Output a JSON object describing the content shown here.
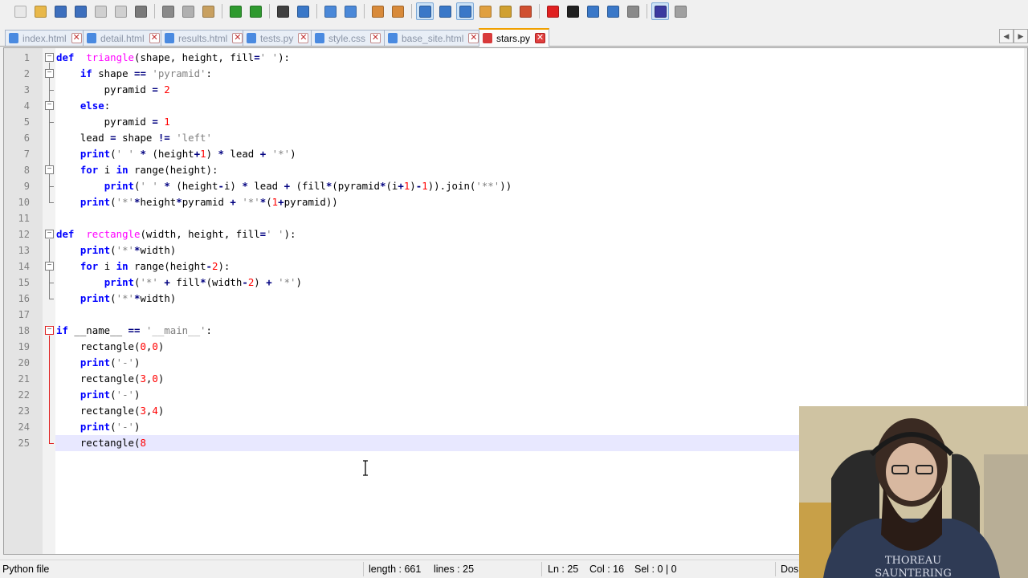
{
  "toolbar": {
    "buttons": [
      {
        "icon": "new-file-icon",
        "color": "#e8e8e8"
      },
      {
        "icon": "open-file-icon",
        "color": "#e8b84a"
      },
      {
        "icon": "save-icon",
        "color": "#3d6fbd"
      },
      {
        "icon": "save-all-icon",
        "color": "#3d6fbd"
      },
      {
        "icon": "close-icon",
        "color": "#d0d0d0"
      },
      {
        "icon": "close-all-icon",
        "color": "#d0d0d0"
      },
      {
        "icon": "print-icon",
        "color": "#7a7a7a"
      },
      {
        "sep": true
      },
      {
        "icon": "cut-icon",
        "color": "#8a8a8a"
      },
      {
        "icon": "copy-icon",
        "color": "#b0b0b0"
      },
      {
        "icon": "paste-icon",
        "color": "#c8a060"
      },
      {
        "sep": true
      },
      {
        "icon": "undo-icon",
        "color": "#2f9a2f"
      },
      {
        "icon": "redo-icon",
        "color": "#2f9a2f"
      },
      {
        "sep": true
      },
      {
        "icon": "find-icon",
        "color": "#404040"
      },
      {
        "icon": "replace-icon",
        "color": "#3a78c8"
      },
      {
        "sep": true
      },
      {
        "icon": "zoom-in-icon",
        "color": "#4a88d8"
      },
      {
        "icon": "zoom-out-icon",
        "color": "#4a88d8"
      },
      {
        "sep": true
      },
      {
        "icon": "sync-vertical-icon",
        "color": "#d88a3a"
      },
      {
        "icon": "sync-horizontal-icon",
        "color": "#d88a3a"
      },
      {
        "sep": true
      },
      {
        "icon": "word-wrap-icon",
        "color": "#3a78c8",
        "pressed": true
      },
      {
        "icon": "show-all-chars-icon",
        "color": "#3a78c8"
      },
      {
        "icon": "indent-guide-icon",
        "color": "#3a78c8",
        "pressed": true
      },
      {
        "icon": "user-language-icon",
        "color": "#e0a040"
      },
      {
        "icon": "doc-map-icon",
        "color": "#d0a030"
      },
      {
        "icon": "function-list-icon",
        "color": "#d05030"
      },
      {
        "sep": true
      },
      {
        "icon": "record-macro-icon",
        "color": "#e02020"
      },
      {
        "icon": "stop-macro-icon",
        "color": "#202020"
      },
      {
        "icon": "play-macro-icon",
        "color": "#3a78c8"
      },
      {
        "icon": "run-macro-multiple-icon",
        "color": "#3a78c8"
      },
      {
        "icon": "save-macro-icon",
        "color": "#8a8a8a"
      },
      {
        "sep": true
      },
      {
        "icon": "spell-check-icon",
        "color": "#3a3aa0",
        "pressed": true
      },
      {
        "icon": "dspellcheck-settings-icon",
        "color": "#a0a0a0"
      }
    ]
  },
  "tabs": [
    {
      "label": "index.html",
      "active": false
    },
    {
      "label": "detail.html",
      "active": false
    },
    {
      "label": "results.html",
      "active": false
    },
    {
      "label": "tests.py",
      "active": false
    },
    {
      "label": "style.css",
      "active": false
    },
    {
      "label": "base_site.html",
      "active": false
    },
    {
      "label": "stars.py",
      "active": true
    }
  ],
  "tab_close_glyph": "✕",
  "tab_scroll": {
    "left": "◀",
    "right": "▶"
  },
  "editor": {
    "current_line": 25,
    "lines": [
      {
        "n": "1",
        "tokens": [
          [
            "kw",
            "def"
          ],
          [
            "",
            "  "
          ],
          [
            "fn",
            "triangle"
          ],
          [
            "",
            "(shape, height, fill"
          ],
          [
            "op",
            "="
          ],
          [
            "str",
            "' '"
          ],
          [
            "",
            "):"
          ]
        ]
      },
      {
        "n": "2",
        "tokens": [
          [
            "",
            "    "
          ],
          [
            "kw",
            "if"
          ],
          [
            "",
            " shape "
          ],
          [
            "op",
            "=="
          ],
          [
            "",
            " "
          ],
          [
            "str",
            "'pyramid'"
          ],
          [
            "",
            ":"
          ]
        ]
      },
      {
        "n": "3",
        "tokens": [
          [
            "",
            "        pyramid "
          ],
          [
            "op",
            "="
          ],
          [
            "",
            " "
          ],
          [
            "num",
            "2"
          ]
        ]
      },
      {
        "n": "4",
        "tokens": [
          [
            "",
            "    "
          ],
          [
            "kw",
            "else"
          ],
          [
            "",
            ":"
          ]
        ]
      },
      {
        "n": "5",
        "tokens": [
          [
            "",
            "        pyramid "
          ],
          [
            "op",
            "="
          ],
          [
            "",
            " "
          ],
          [
            "num",
            "1"
          ]
        ]
      },
      {
        "n": "6",
        "tokens": [
          [
            "",
            "    lead "
          ],
          [
            "op",
            "="
          ],
          [
            "",
            " shape "
          ],
          [
            "op",
            "!="
          ],
          [
            "",
            " "
          ],
          [
            "str",
            "'left'"
          ]
        ]
      },
      {
        "n": "7",
        "tokens": [
          [
            "",
            "    "
          ],
          [
            "kw",
            "print"
          ],
          [
            "",
            "("
          ],
          [
            "str",
            "' '"
          ],
          [
            "",
            " "
          ],
          [
            "op",
            "*"
          ],
          [
            "",
            " (height"
          ],
          [
            "op",
            "+"
          ],
          [
            "num",
            "1"
          ],
          [
            "",
            ") "
          ],
          [
            "op",
            "*"
          ],
          [
            "",
            " lead "
          ],
          [
            "op",
            "+"
          ],
          [
            "",
            " "
          ],
          [
            "str",
            "'*'"
          ],
          [
            "",
            ")"
          ]
        ]
      },
      {
        "n": "8",
        "tokens": [
          [
            "",
            "    "
          ],
          [
            "kw",
            "for"
          ],
          [
            "",
            " i "
          ],
          [
            "kw",
            "in"
          ],
          [
            "",
            " range(height):"
          ]
        ]
      },
      {
        "n": "9",
        "tokens": [
          [
            "",
            "        "
          ],
          [
            "kw",
            "print"
          ],
          [
            "",
            "("
          ],
          [
            "str",
            "' '"
          ],
          [
            "",
            " "
          ],
          [
            "op",
            "*"
          ],
          [
            "",
            " (height"
          ],
          [
            "op",
            "-"
          ],
          [
            "",
            "i) "
          ],
          [
            "op",
            "*"
          ],
          [
            "",
            " lead "
          ],
          [
            "op",
            "+"
          ],
          [
            "",
            " (fill"
          ],
          [
            "op",
            "*"
          ],
          [
            "",
            "(pyramid"
          ],
          [
            "op",
            "*"
          ],
          [
            "",
            "(i"
          ],
          [
            "op",
            "+"
          ],
          [
            "num",
            "1"
          ],
          [
            "",
            ")"
          ],
          [
            "op",
            "-"
          ],
          [
            "num",
            "1"
          ],
          [
            "",
            "))"
          ],
          [
            "",
            ".join("
          ],
          [
            "str",
            "'**'"
          ],
          [
            "",
            "))"
          ]
        ]
      },
      {
        "n": "10",
        "tokens": [
          [
            "",
            "    "
          ],
          [
            "kw",
            "print"
          ],
          [
            "",
            "("
          ],
          [
            "str",
            "'*'"
          ],
          [
            "op",
            "*"
          ],
          [
            "",
            "height"
          ],
          [
            "op",
            "*"
          ],
          [
            "",
            "pyramid "
          ],
          [
            "op",
            "+"
          ],
          [
            "",
            " "
          ],
          [
            "str",
            "'*'"
          ],
          [
            "op",
            "*"
          ],
          [
            "",
            "("
          ],
          [
            "num",
            "1"
          ],
          [
            "op",
            "+"
          ],
          [
            "",
            "pyramid))"
          ]
        ]
      },
      {
        "n": "11",
        "tokens": []
      },
      {
        "n": "12",
        "tokens": [
          [
            "kw",
            "def"
          ],
          [
            "",
            "  "
          ],
          [
            "fn",
            "rectangle"
          ],
          [
            "",
            "(width, height, fill"
          ],
          [
            "op",
            "="
          ],
          [
            "str",
            "' '"
          ],
          [
            "",
            "):"
          ]
        ]
      },
      {
        "n": "13",
        "tokens": [
          [
            "",
            "    "
          ],
          [
            "kw",
            "print"
          ],
          [
            "",
            "("
          ],
          [
            "str",
            "'*'"
          ],
          [
            "op",
            "*"
          ],
          [
            "",
            "width)"
          ]
        ]
      },
      {
        "n": "14",
        "tokens": [
          [
            "",
            "    "
          ],
          [
            "kw",
            "for"
          ],
          [
            "",
            " i "
          ],
          [
            "kw",
            "in"
          ],
          [
            "",
            " range(height"
          ],
          [
            "op",
            "-"
          ],
          [
            "num",
            "2"
          ],
          [
            "",
            "):"
          ]
        ]
      },
      {
        "n": "15",
        "tokens": [
          [
            "",
            "        "
          ],
          [
            "kw",
            "print"
          ],
          [
            "",
            "("
          ],
          [
            "str",
            "'*'"
          ],
          [
            "",
            " "
          ],
          [
            "op",
            "+"
          ],
          [
            "",
            " fill"
          ],
          [
            "op",
            "*"
          ],
          [
            "",
            "(width"
          ],
          [
            "op",
            "-"
          ],
          [
            "num",
            "2"
          ],
          [
            "",
            ") "
          ],
          [
            "op",
            "+"
          ],
          [
            "",
            " "
          ],
          [
            "str",
            "'*'"
          ],
          [
            "",
            ")"
          ]
        ]
      },
      {
        "n": "16",
        "tokens": [
          [
            "",
            "    "
          ],
          [
            "kw",
            "print"
          ],
          [
            "",
            "("
          ],
          [
            "str",
            "'*'"
          ],
          [
            "op",
            "*"
          ],
          [
            "",
            "width)"
          ]
        ]
      },
      {
        "n": "17",
        "tokens": []
      },
      {
        "n": "18",
        "tokens": [
          [
            "kw",
            "if"
          ],
          [
            "",
            " __name__ "
          ],
          [
            "op",
            "=="
          ],
          [
            "",
            " "
          ],
          [
            "str",
            "'__main__'"
          ],
          [
            "",
            ":"
          ]
        ]
      },
      {
        "n": "19",
        "tokens": [
          [
            "",
            "    rectangle("
          ],
          [
            "num",
            "0"
          ],
          [
            "",
            ","
          ],
          [
            "num",
            "0"
          ],
          [
            "",
            ")"
          ]
        ]
      },
      {
        "n": "20",
        "tokens": [
          [
            "",
            "    "
          ],
          [
            "kw",
            "print"
          ],
          [
            "",
            "("
          ],
          [
            "str",
            "'-'"
          ],
          [
            "",
            ")"
          ]
        ]
      },
      {
        "n": "21",
        "tokens": [
          [
            "",
            "    rectangle("
          ],
          [
            "num",
            "3"
          ],
          [
            "",
            ","
          ],
          [
            "num",
            "0"
          ],
          [
            "",
            ")"
          ]
        ]
      },
      {
        "n": "22",
        "tokens": [
          [
            "",
            "    "
          ],
          [
            "kw",
            "print"
          ],
          [
            "",
            "("
          ],
          [
            "str",
            "'-'"
          ],
          [
            "",
            ")"
          ]
        ]
      },
      {
        "n": "23",
        "tokens": [
          [
            "",
            "    rectangle("
          ],
          [
            "num",
            "3"
          ],
          [
            "",
            ","
          ],
          [
            "num",
            "4"
          ],
          [
            "",
            ")"
          ]
        ]
      },
      {
        "n": "24",
        "tokens": [
          [
            "",
            "    "
          ],
          [
            "kw",
            "print"
          ],
          [
            "",
            "("
          ],
          [
            "str",
            "'-'"
          ],
          [
            "",
            ")"
          ]
        ]
      },
      {
        "n": "25",
        "tokens": [
          [
            "",
            "    rectangle("
          ],
          [
            "num",
            "8"
          ]
        ]
      }
    ]
  },
  "status": {
    "file_type": "Python file",
    "length": "length : 661",
    "lines": "lines : 25",
    "ln": "Ln : 25",
    "col": "Col : 16",
    "sel": "Sel : 0 | 0",
    "eol": "Dos"
  },
  "webcam": {
    "shirt_text_1": "THOREAU",
    "shirt_text_2": "SAUNTERING"
  }
}
